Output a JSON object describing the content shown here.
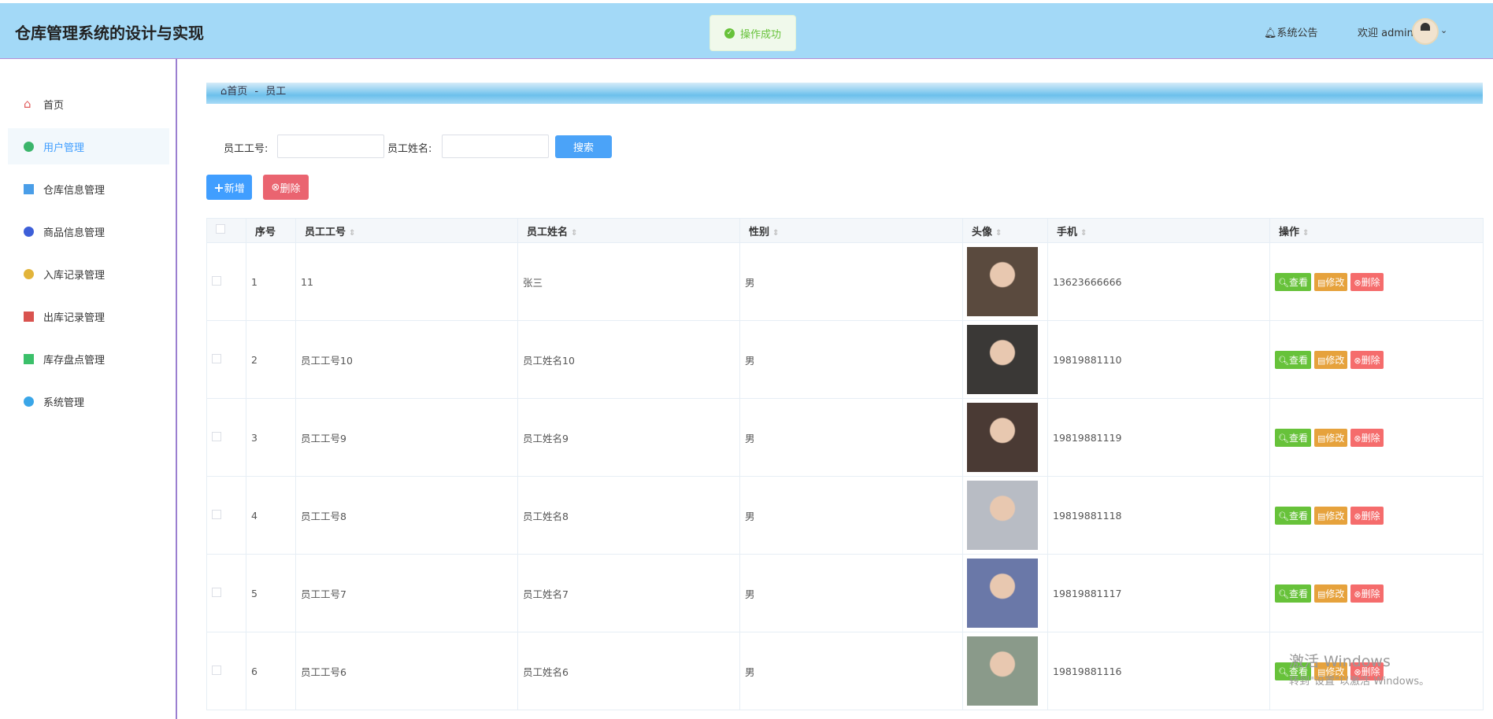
{
  "header": {
    "title": "仓库管理系统的设计与实现",
    "toast": "操作成功",
    "notice": "系统公告",
    "welcome": "欢迎 admin"
  },
  "sidebar": {
    "items": [
      {
        "label": "首页",
        "icon": "home-icon",
        "color": "#e05a5a"
      },
      {
        "label": "用户管理",
        "icon": "user-badge-icon",
        "color": "#3bb56b"
      },
      {
        "label": "仓库信息管理",
        "icon": "grid-icon",
        "color": "#4a9ee8"
      },
      {
        "label": "商品信息管理",
        "icon": "circle-icon",
        "color": "#3d5fd8"
      },
      {
        "label": "入库记录管理",
        "icon": "circle-icon",
        "color": "#e2b43a"
      },
      {
        "label": "出库记录管理",
        "icon": "box-icon",
        "color": "#d9534f"
      },
      {
        "label": "库存盘点管理",
        "icon": "clover-icon",
        "color": "#3bc06a"
      },
      {
        "label": "系统管理",
        "icon": "circle-icon",
        "color": "#3aa6e8"
      }
    ],
    "active": 1
  },
  "breadcrumb": {
    "home": "首页",
    "sep": "-",
    "current": "员工"
  },
  "search": {
    "id_label": "员工工号:",
    "name_label": "员工姓名:",
    "id_value": "",
    "name_value": "",
    "button": "搜索"
  },
  "actions": {
    "add": "新增",
    "delete": "删除"
  },
  "table": {
    "columns": [
      "序号",
      "员工工号",
      "员工姓名",
      "性别",
      "头像",
      "手机",
      "操作"
    ],
    "rows": [
      {
        "no": "1",
        "id": "11",
        "name": "张三",
        "gender": "男",
        "phone": "13623666666",
        "photo": "#5a4a3e"
      },
      {
        "no": "2",
        "id": "员工工号10",
        "name": "员工姓名10",
        "gender": "男",
        "phone": "19819881110",
        "photo": "#3a3836"
      },
      {
        "no": "3",
        "id": "员工工号9",
        "name": "员工姓名9",
        "gender": "男",
        "phone": "19819881119",
        "photo": "#4a3a34"
      },
      {
        "no": "4",
        "id": "员工工号8",
        "name": "员工姓名8",
        "gender": "男",
        "phone": "19819881118",
        "photo": "#b8bcc4"
      },
      {
        "no": "5",
        "id": "员工工号7",
        "name": "员工姓名7",
        "gender": "男",
        "phone": "19819881117",
        "photo": "#6a78a8"
      },
      {
        "no": "6",
        "id": "员工工号6",
        "name": "员工姓名6",
        "gender": "男",
        "phone": "19819881116",
        "photo": "#8a9a8a"
      }
    ],
    "row_actions": {
      "view": "查看",
      "edit": "修改",
      "delete": "删除"
    }
  },
  "watermark": {
    "line1": "激活 Windows",
    "line2": "转到\"设置\"以激活 Windows。"
  },
  "colors": {
    "primary": "#409eff",
    "success": "#67c23a",
    "warning": "#e6a23c",
    "danger": "#f56c6c"
  }
}
